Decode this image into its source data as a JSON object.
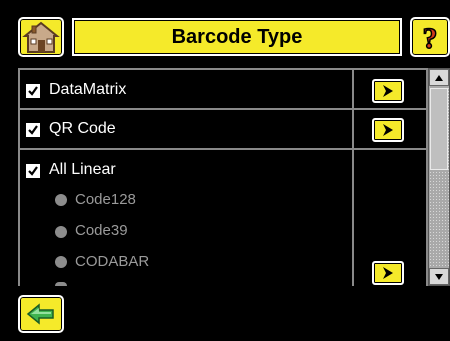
{
  "header": {
    "title": "Barcode Type",
    "home_icon": "home-icon",
    "help_icon": "question-mark-icon",
    "help_glyph": "?"
  },
  "list": {
    "items": [
      {
        "label": "DataMatrix",
        "checked": true
      },
      {
        "label": "QR Code",
        "checked": true
      },
      {
        "label": "All Linear",
        "checked": true,
        "sub_options": [
          {
            "label": "Code128"
          },
          {
            "label": "Code39"
          },
          {
            "label": "CODABAR"
          }
        ]
      }
    ]
  },
  "footer": {
    "back_icon": "back-arrow-icon"
  },
  "colors": {
    "accent": "#f5ea2a",
    "background": "#000000",
    "border": "#8a8a8a",
    "disabled_text": "#9a9a9a"
  }
}
